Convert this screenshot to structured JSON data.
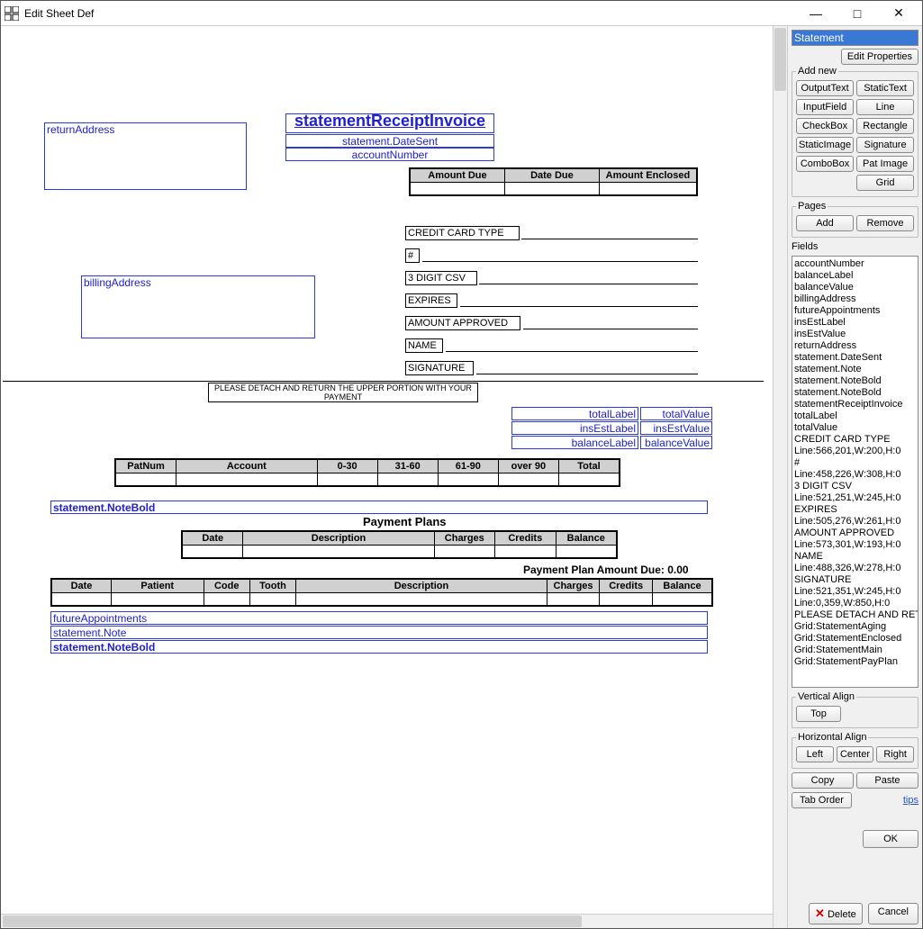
{
  "titlebar": {
    "title": "Edit Sheet Def"
  },
  "side": {
    "selected_name": "Statement",
    "edit_properties": "Edit Properties",
    "addnew_legend": "Add new",
    "addnew_buttons": [
      "OutputText",
      "StaticText",
      "InputField",
      "Line",
      "CheckBox",
      "Rectangle",
      "StaticImage",
      "Signature",
      "ComboBox",
      "Pat Image",
      "Grid"
    ],
    "pages_legend": "Pages",
    "pages_add": "Add",
    "pages_remove": "Remove",
    "fields_label": "Fields",
    "fields_list": [
      "accountNumber",
      "balanceLabel",
      "balanceValue",
      "billingAddress",
      "futureAppointments",
      "insEstLabel",
      "insEstValue",
      "returnAddress",
      "statement.DateSent",
      "statement.Note",
      "statement.NoteBold",
      "statement.NoteBold",
      "statementReceiptInvoice",
      "totalLabel",
      "totalValue",
      "CREDIT CARD TYPE",
      "Line:566,201,W:200,H:0",
      "#",
      "Line:458,226,W:308,H:0",
      "3 DIGIT CSV",
      "Line:521,251,W:245,H:0",
      "EXPIRES",
      "Line:505,276,W:261,H:0",
      "AMOUNT APPROVED",
      "Line:573,301,W:193,H:0",
      "NAME",
      "Line:488,326,W:278,H:0",
      "SIGNATURE",
      "Line:521,351,W:245,H:0",
      "Line:0,359,W:850,H:0",
      "PLEASE DETACH AND RETURN THE UPPER PORTION WITH YOUR PAYMENT",
      "Grid:StatementAging",
      "Grid:StatementEnclosed",
      "Grid:StatementMain",
      "Grid:StatementPayPlan"
    ],
    "valign_legend": "Vertical Align",
    "valign_top": "Top",
    "halign_legend": "Horizontal Align",
    "halign_left": "Left",
    "halign_center": "Center",
    "halign_right": "Right",
    "copy": "Copy",
    "paste": "Paste",
    "tab_order": "Tab Order",
    "tips": "tips",
    "ok": "OK",
    "delete": "Delete",
    "cancel": "Cancel"
  },
  "canvas": {
    "returnAddress": "returnAddress",
    "statementReceiptInvoice": "statementReceiptInvoice",
    "dateSent": "statement.DateSent",
    "accountNumber": "accountNumber",
    "grid_enclosed_headers": [
      "Amount Due",
      "Date Due",
      "Amount Enclosed"
    ],
    "cc_type": "CREDIT CARD TYPE",
    "hash": "#",
    "csv": "3 DIGIT CSV",
    "expires": "EXPIRES",
    "amount_approved": "AMOUNT APPROVED",
    "name": "NAME",
    "signature": "SIGNATURE",
    "billingAddress": "billingAddress",
    "detach": "PLEASE DETACH AND RETURN THE UPPER PORTION WITH YOUR PAYMENT",
    "totalLabel": "totalLabel",
    "totalValue": "totalValue",
    "insEstLabel": "insEstLabel",
    "insEstValue": "insEstValue",
    "balanceLabel": "balanceLabel",
    "balanceValue": "balanceValue",
    "aging_headers": [
      "PatNum",
      "Account",
      "0-30",
      "31-60",
      "61-90",
      "over 90",
      "Total"
    ],
    "noteBold1": "statement.NoteBold",
    "payplans_title": "Payment Plans",
    "payplan_headers": [
      "Date",
      "Description",
      "Charges",
      "Credits",
      "Balance"
    ],
    "payplan_due": "Payment Plan Amount Due: 0.00",
    "main_headers": [
      "Date",
      "Patient",
      "Code",
      "Tooth",
      "Description",
      "Charges",
      "Credits",
      "Balance"
    ],
    "futureAppointments": "futureAppointments",
    "note": "statement.Note",
    "noteBold2": "statement.NoteBold"
  }
}
